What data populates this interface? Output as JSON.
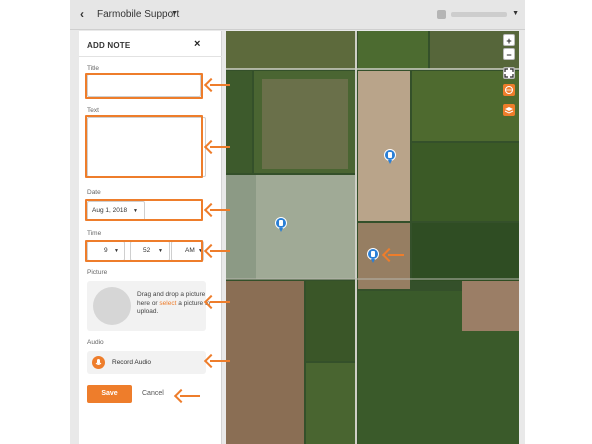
{
  "header": {
    "back_icon": "chevron-left-icon",
    "organization": "Farmobile Support",
    "user_icon": "avatar-icon"
  },
  "form": {
    "title": "ADD NOTE",
    "close_label": "×",
    "fields": {
      "title_label": "Title",
      "title_value": "",
      "text_label": "Text",
      "text_value": "",
      "date_label": "Date",
      "date_value": "Aug 1, 2018",
      "time_label": "Time",
      "time_hour": "9",
      "time_minute": "52",
      "time_ampm": "AM",
      "picture_label": "Picture",
      "picture_prompt_before": "Drag and drop a picture here or",
      "picture_link": "select",
      "picture_prompt_after": "a picture to upload.",
      "audio_label": "Audio",
      "record_label": "Record Audio"
    },
    "actions": {
      "save_label": "Save",
      "cancel_label": "Cancel"
    }
  },
  "map": {
    "zoom_in_label": "+",
    "zoom_out_label": "−",
    "controls": [
      "zoom-in-icon",
      "zoom-out-icon",
      "fullscreen-icon",
      "globe-icon",
      "layers-icon"
    ],
    "pins": [
      "note-pin-icon",
      "note-pin-icon",
      "note-pin-icon"
    ]
  },
  "colors": {
    "accent": "#ee7d2b",
    "pin": "#2a7fd6"
  }
}
